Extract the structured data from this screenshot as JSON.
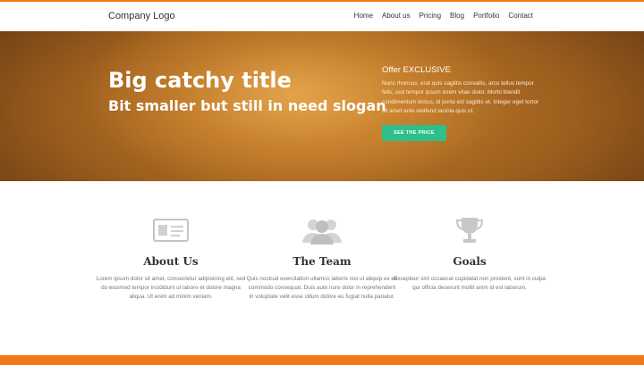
{
  "header": {
    "logo": "Company Logo",
    "nav": [
      "Home",
      "About us",
      "Pricing",
      "Blog",
      "Portfolio",
      "Contact"
    ]
  },
  "hero": {
    "title": "Big catchy title",
    "subtitle": "Bit smaller but still in need slogan",
    "offer_title": "Offer EXCLUSIVE",
    "offer_text": "Nunc rhoncus, erat quis sagittis convallis, arcu tellus tempor felis, sed tempor ipsum lorem vitae dolor. Morbi blandit condimentum lectus, id porta est sagittis et. Integer eget tortor sit amet ante eleifend lacinia quis ut.",
    "cta_label": "SEE THE PRICE"
  },
  "features": [
    {
      "icon": "id-card-icon",
      "title": "About Us",
      "text": "Lorem ipsum dolor sit amet, consectetur adipisicing elit, sed do eiusmod tempor incididunt ut labore et dolore magna aliqua. Ut enim ad minim veniam."
    },
    {
      "icon": "team-icon",
      "title": "The Team",
      "text": "Quis nostrud exercitation ullamco laboris nisi ut aliquip ex ea commodo consequat. Duis aute irure dolor in reprehenderit in voluptate velit esse cillum dolore eu fugiat nulla pariatur."
    },
    {
      "icon": "trophy-icon",
      "title": "Goals",
      "text": "Excepteur sint occaecat cupidatat non proident, sunt in culpa qui officia deserunt mollit anim id est laborum."
    }
  ],
  "colors": {
    "accent": "#f07a1a",
    "cta": "#2ec08a",
    "hero": "#c98331"
  }
}
